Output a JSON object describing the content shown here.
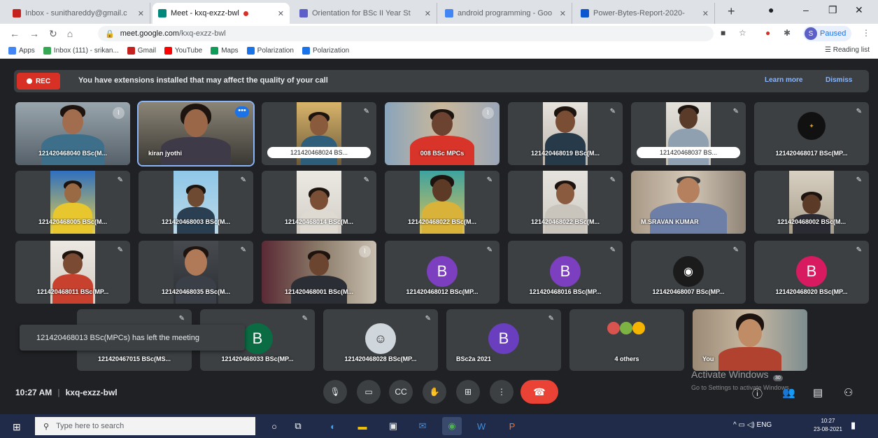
{
  "browser": {
    "tabs": [
      {
        "title": "Inbox - sunithareddy@gmail.c",
        "color": "#c5221f"
      },
      {
        "title": "Meet - kxq-exzz-bwl",
        "color": "#00897b"
      },
      {
        "title": "Orientation for BSc II Year St",
        "color": "#5b5fc7"
      },
      {
        "title": "android programming - Goo",
        "color": "#4285f4"
      },
      {
        "title": "Power-Bytes-Report-2020-",
        "color": "#0b57d0"
      }
    ],
    "url_host": "meet.google.com",
    "url_path": "/kxq-exzz-bwl",
    "profile_label": "Paused",
    "profile_initial": "S",
    "bookmarks": [
      {
        "label": "Apps",
        "color": "#4285f4"
      },
      {
        "label": "Inbox (111) - srikan...",
        "color": "#34a853"
      },
      {
        "label": "Gmail",
        "color": "#c5221f"
      },
      {
        "label": "YouTube",
        "color": "#ff0000"
      },
      {
        "label": "Maps",
        "color": "#0f9d58"
      },
      {
        "label": "Polarization",
        "color": "#1a73e8"
      },
      {
        "label": "Polarization",
        "color": "#1a73e8"
      }
    ],
    "reading_list": "Reading list"
  },
  "notice": {
    "rec": "REC",
    "text": "You have extensions installed that may affect the quality of your call",
    "learn_more": "Learn more",
    "dismiss": "Dismiss"
  },
  "participants": [
    {
      "name": "121420468040 BSc(M..."
    },
    {
      "name": "kiran jyothi"
    },
    {
      "name": "121420468024 BS..."
    },
    {
      "name": "008 BSc MPCs"
    },
    {
      "name": "121420468019 BSc(M..."
    },
    {
      "name": "121420468037 BS..."
    },
    {
      "name": "121420468017 BSc(MP..."
    },
    {
      "name": "121420468005 BSc(M..."
    },
    {
      "name": "121420468003 BSc(M..."
    },
    {
      "name": "121420468014 BSc(M..."
    },
    {
      "name": "121420468022 BSc(M..."
    },
    {
      "name": "121420468022 BSc(M..."
    },
    {
      "name": "M.SRAVAN KUMAR"
    },
    {
      "name": "121420468002 BSc(M..."
    },
    {
      "name": "121420468011 BSc(MP..."
    },
    {
      "name": "121420468035 BSc(M..."
    },
    {
      "name": "121420468001 BSc(M..."
    },
    {
      "name": "121420468012 BSc(MP...",
      "initial": "B",
      "color": "#7b3fbf"
    },
    {
      "name": "121420468016 BSc(MP...",
      "initial": "B",
      "color": "#7b3fbf"
    },
    {
      "name": "121420468007 BSc(MP..."
    },
    {
      "name": "121420468020 BSc(MP...",
      "initial": "B",
      "color": "#d81b60"
    },
    {
      "name": "121420467015 BSc(MS..."
    },
    {
      "name": "121420468033 BSc(MP...",
      "initial": "B",
      "color": "#0b6b43"
    },
    {
      "name": "121420468028 BSc(MP..."
    },
    {
      "name": "BSc2a 2021",
      "initial": "B",
      "color": "#6a3fbf"
    },
    {
      "name": "4 others"
    },
    {
      "name": "You"
    }
  ],
  "toast": "121420468013 BSc(MPCs) has left the meeting",
  "meeting": {
    "time": "10:27 AM",
    "code": "kxq-exzz-bwl"
  },
  "activate": {
    "title": "Activate Windows",
    "sub": "Go to Settings to activate Windows."
  },
  "people_count": "30",
  "taskbar": {
    "search_placeholder": "Type here to search",
    "lang": "ENG",
    "time": "10:27",
    "date": "23-08-2021"
  }
}
